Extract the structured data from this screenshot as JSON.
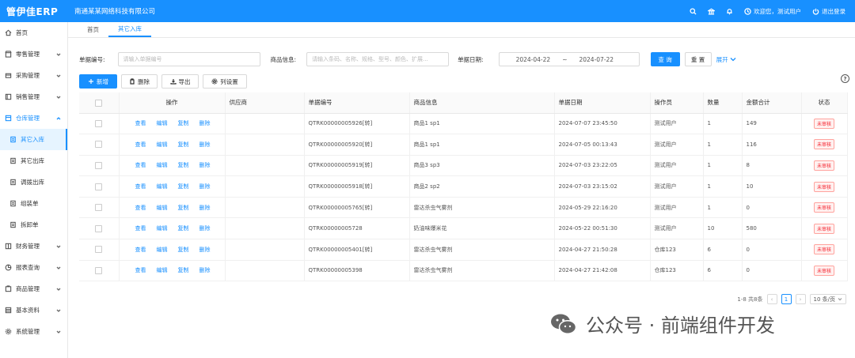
{
  "app": {
    "brand": "管伊佳ERP",
    "company": "南通某某网络科技有限公司",
    "welcome": "欢迎您，测试用户",
    "logout": "退出登录"
  },
  "sidebar": {
    "items": [
      {
        "label": "首页",
        "icon": "home-icon"
      },
      {
        "label": "零售管理",
        "icon": "shop-icon"
      },
      {
        "label": "采购管理",
        "icon": "cart-icon"
      },
      {
        "label": "销售管理",
        "icon": "sales-icon"
      },
      {
        "label": "仓库管理",
        "icon": "warehouse-icon"
      },
      {
        "label": "其它入库",
        "icon": "doc-icon"
      },
      {
        "label": "其它出库",
        "icon": "doc-icon"
      },
      {
        "label": "调拨出库",
        "icon": "doc-icon"
      },
      {
        "label": "组装单",
        "icon": "doc-icon"
      },
      {
        "label": "拆卸单",
        "icon": "doc-icon"
      },
      {
        "label": "财务管理",
        "icon": "finance-icon"
      },
      {
        "label": "报表查询",
        "icon": "chart-icon"
      },
      {
        "label": "商品管理",
        "icon": "goods-icon"
      },
      {
        "label": "基本资料",
        "icon": "database-icon"
      },
      {
        "label": "系统管理",
        "icon": "gear-icon"
      }
    ]
  },
  "tabs": [
    {
      "label": "首页"
    },
    {
      "label": "其它入库"
    }
  ],
  "search": {
    "bill_no_label": "单据编号:",
    "bill_no_placeholder": "请输入单据编号",
    "goods_label": "商品信息:",
    "goods_placeholder": "请输入条码、名称、规格、型号、颜色、扩展...",
    "date_label": "单据日期:",
    "date_start": "2024-04-22",
    "date_sep": "~",
    "date_end": "2024-07-22",
    "query_label": "查 询",
    "reset_label": "重 置",
    "expand_label": "展开"
  },
  "toolbar": {
    "add_label": "新增",
    "delete_label": "删除",
    "export_label": "导出",
    "columns_label": "列设置"
  },
  "table": {
    "headers": [
      "操作",
      "供应商",
      "单据编号",
      "商品信息",
      "单据日期",
      "操作员",
      "数量",
      "金额合计",
      "状态"
    ],
    "ops": [
      "查看",
      "编辑",
      "复制",
      "删除"
    ],
    "rows": [
      {
        "supplier": "",
        "bill_no": "QTRK00000005926[转]",
        "goods": "商品1 sp1",
        "date": "2024-07-07 23:45:50",
        "operator": "测试用户",
        "qty": "1",
        "amount": "149",
        "status": "未审核"
      },
      {
        "supplier": "",
        "bill_no": "QTRK00000005920[转]",
        "goods": "商品1 sp1",
        "date": "2024-07-05 00:13:43",
        "operator": "测试用户",
        "qty": "1",
        "amount": "116",
        "status": "未审核"
      },
      {
        "supplier": "",
        "bill_no": "QTRK00000005919[转]",
        "goods": "商品3 sp3",
        "date": "2024-07-03 23:22:05",
        "operator": "测试用户",
        "qty": "1",
        "amount": "8",
        "status": "未审核"
      },
      {
        "supplier": "",
        "bill_no": "QTRK00000005918[转]",
        "goods": "商品2 sp2",
        "date": "2024-07-03 23:15:02",
        "operator": "测试用户",
        "qty": "1",
        "amount": "10",
        "status": "未审核"
      },
      {
        "supplier": "",
        "bill_no": "QTRK00000005765[转]",
        "goods": "雷达杀虫气雾剂",
        "date": "2024-05-29 22:16:20",
        "operator": "测试用户",
        "qty": "1",
        "amount": "0",
        "status": "未审核"
      },
      {
        "supplier": "",
        "bill_no": "QTRK00000005728",
        "goods": "奶油味爆米花",
        "date": "2024-05-22 00:51:30",
        "operator": "测试用户",
        "qty": "10",
        "amount": "580",
        "status": "未审核"
      },
      {
        "supplier": "",
        "bill_no": "QTRK00000005401[转]",
        "goods": "雷达杀虫气雾剂",
        "date": "2024-04-27 21:50:28",
        "operator": "仓库123",
        "qty": "6",
        "amount": "0",
        "status": "未审核"
      },
      {
        "supplier": "",
        "bill_no": "QTRK00000005398",
        "goods": "雷达杀虫气雾剂",
        "date": "2024-04-27 21:42:08",
        "operator": "仓库123",
        "qty": "6",
        "amount": "0",
        "status": "未审核"
      }
    ]
  },
  "pagination": {
    "summary": "1-8 共8条",
    "current_page": "1",
    "page_size": "10 条/页"
  },
  "watermark": {
    "text": "公众号 · 前端组件开发"
  },
  "colors": {
    "primary": "#1890ff",
    "status_red": "#f5222d"
  }
}
